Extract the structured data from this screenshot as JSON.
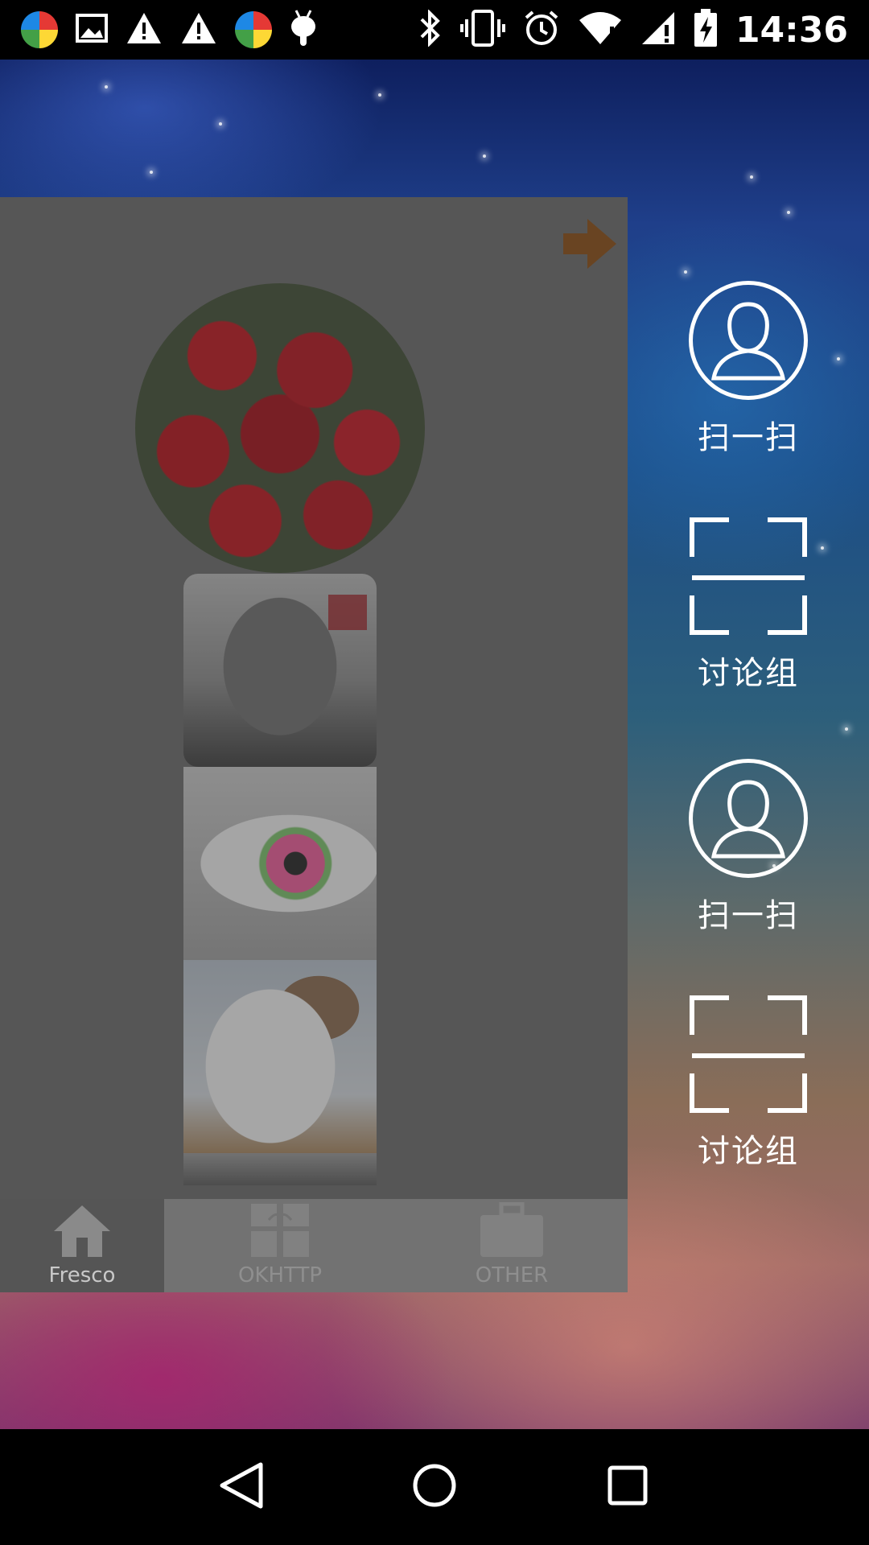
{
  "status_bar": {
    "time": "14:36",
    "left_icons": [
      "app-colorball-icon",
      "image-icon",
      "warning-icon",
      "warning-icon",
      "app-colorball-icon",
      "android-icon"
    ],
    "right_icons": [
      "bluetooth-icon",
      "vibrate-icon",
      "alarm-icon",
      "wifi-icon",
      "signal-icon",
      "battery-charging-icon"
    ]
  },
  "content_panel": {
    "next_button_icon": "arrow-right-icon",
    "images": [
      "rose-bouquet-circle",
      "soldier-photo",
      "rainbow-eye-photo",
      "cat-photo",
      "soldier-photo-partial"
    ]
  },
  "bottom_tabs": [
    {
      "label": "Fresco",
      "icon": "home-icon",
      "active": true
    },
    {
      "label": "OKHTTP",
      "icon": "gift-icon",
      "active": false
    },
    {
      "label": "OTHER",
      "icon": "bag-icon",
      "active": false
    }
  ],
  "right_menu": [
    {
      "label": "扫一扫",
      "icon": "user-circle-icon"
    },
    {
      "label": "讨论组",
      "icon": "scan-frame-icon"
    },
    {
      "label": "扫一扫",
      "icon": "user-circle-icon"
    },
    {
      "label": "讨论组",
      "icon": "scan-frame-icon"
    }
  ],
  "colors": {
    "accent_arrow": "#8a4a10",
    "panel": "#6a6a6a",
    "tab_active": "#555555"
  }
}
